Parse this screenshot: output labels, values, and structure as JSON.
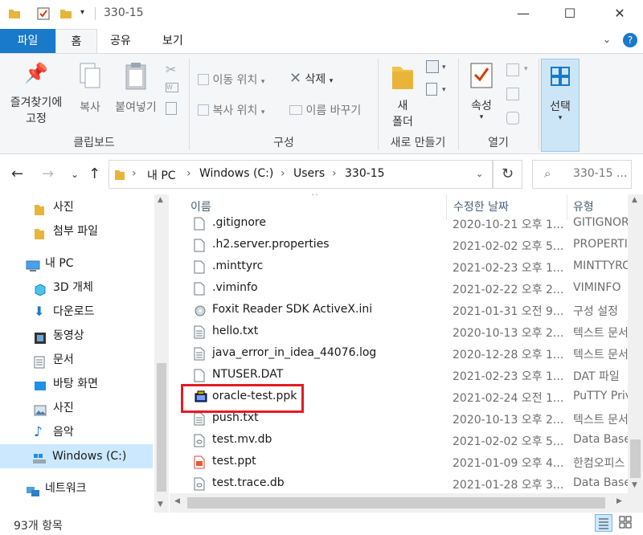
{
  "window": {
    "title": "330-15",
    "minimize": "—",
    "maximize": "☐",
    "close": "✕"
  },
  "ribbon_tabs": [
    "파일",
    "홈",
    "공유",
    "보기"
  ],
  "ribbon": {
    "clipboard": {
      "pin_label_1": "즐겨찾기에",
      "pin_label_2": "고정",
      "copy": "복사",
      "paste": "붙여넣기",
      "group": "클립보드"
    },
    "organize": {
      "move_to": "이동 위치",
      "copy_to": "복사 위치",
      "delete": "삭제",
      "rename": "이름 바꾸기",
      "group": "구성"
    },
    "new": {
      "new_folder_1": "새",
      "new_folder_2": "폴더",
      "group": "새로 만들기"
    },
    "open": {
      "properties": "속성",
      "group": "열기"
    },
    "select": {
      "select": "선택"
    }
  },
  "address": {
    "crumbs": [
      "내 PC",
      "Windows (C:)",
      "Users",
      "330-15"
    ],
    "search_placeholder": "330-15 ..."
  },
  "nav": [
    {
      "label": "사진",
      "icon": "folder-icon"
    },
    {
      "label": "첨부 파일",
      "icon": "folder-icon"
    },
    {
      "label": "내 PC",
      "icon": "computer-icon"
    },
    {
      "label": "3D 개체",
      "icon": "3d-objects-icon"
    },
    {
      "label": "다운로드",
      "icon": "download-icon"
    },
    {
      "label": "동영상",
      "icon": "video-icon"
    },
    {
      "label": "문서",
      "icon": "document-icon"
    },
    {
      "label": "바탕 화면",
      "icon": "desktop-icon"
    },
    {
      "label": "사진",
      "icon": "pictures-icon"
    },
    {
      "label": "음악",
      "icon": "music-icon"
    },
    {
      "label": "Windows (C:)",
      "icon": "drive-icon"
    },
    {
      "label": "네트워크",
      "icon": "network-icon"
    }
  ],
  "columns": {
    "name": "이름",
    "date": "수정한 날짜",
    "type": "유형"
  },
  "files": [
    {
      "name": ".gitignore",
      "date": "2020-10-21 오후 1...",
      "type": "GITIGNORE"
    },
    {
      "name": ".h2.server.properties",
      "date": "2021-02-02 오후 5...",
      "type": "PROPERTIES"
    },
    {
      "name": ".minttyrc",
      "date": "2021-02-23 오후 1...",
      "type": "MINTTYRC"
    },
    {
      "name": ".viminfo",
      "date": "2021-02-22 오후 2...",
      "type": "VIMINFO"
    },
    {
      "name": "Foxit Reader SDK ActiveX.ini",
      "date": "2021-01-31 오전 9...",
      "type": "구성 설정"
    },
    {
      "name": "hello.txt",
      "date": "2020-10-13 오후 2...",
      "type": "텍스트 문서"
    },
    {
      "name": "java_error_in_idea_44076.log",
      "date": "2020-12-28 오후 1...",
      "type": "텍스트 문서"
    },
    {
      "name": "NTUSER.DAT",
      "date": "2021-02-23 오후 1...",
      "type": "DAT 파일"
    },
    {
      "name": "oracle-test.ppk",
      "date": "2021-02-24 오전 1...",
      "type": "PuTTY Private"
    },
    {
      "name": "push.txt",
      "date": "2020-10-13 오후 2...",
      "type": "텍스트 문서"
    },
    {
      "name": "test.mv.db",
      "date": "2021-02-02 오후 5...",
      "type": "Data Base"
    },
    {
      "name": "test.ppt",
      "date": "2021-01-09 오후 4...",
      "type": "한컴오피스"
    },
    {
      "name": "test.trace.db",
      "date": "2021-01-28 오후 3...",
      "type": "Data Base"
    }
  ],
  "status": {
    "count": "93개 항목"
  }
}
